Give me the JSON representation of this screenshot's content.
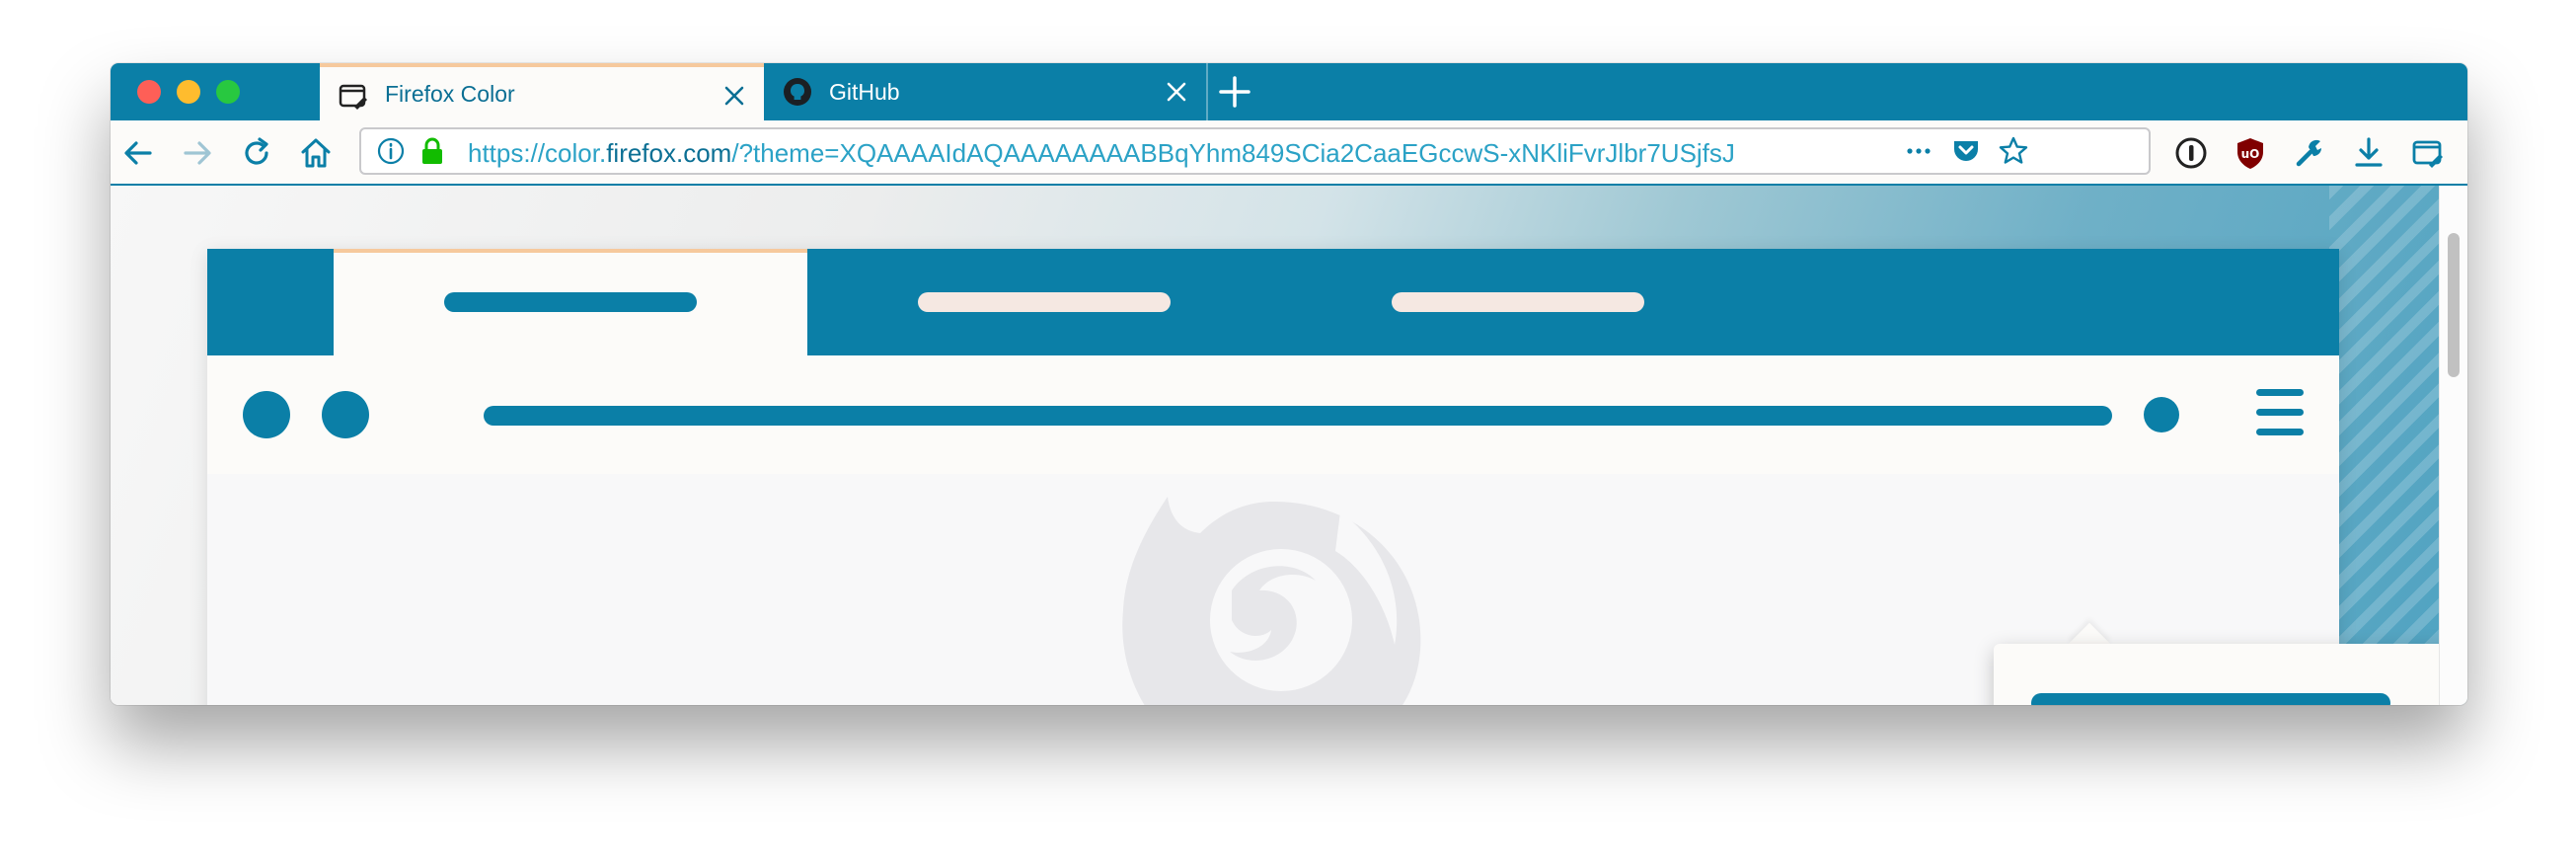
{
  "window": {
    "tabs": [
      {
        "title": "Firefox Color",
        "icon": "firefox-color-icon",
        "active": true
      },
      {
        "title": "GitHub",
        "icon": "github-icon",
        "active": false
      }
    ]
  },
  "navbar": {
    "url": {
      "scheme": "https://color.",
      "host": "firefox.com",
      "rest": "/?theme=XQAAAAIdAQAAAAAAAABBqYhm849SCia2CaaEGccwS-xNKliFvrJlbr7USjfsJ"
    },
    "icons": [
      "back-icon",
      "forward-icon",
      "reload-icon",
      "home-icon",
      "info-icon",
      "lock-icon",
      "more-icon",
      "pocket-icon",
      "bookmark-star-icon",
      "1password-icon",
      "ublock-icon",
      "wrench-icon",
      "download-icon",
      "firefox-color-icon",
      "overflow-icon",
      "menu-icon"
    ]
  },
  "colors": {
    "accent": "#0b7fa7",
    "tab_line": "#f6c99d",
    "toolbar": "#fcfbf9",
    "pill_light": "#f5e8e2"
  }
}
